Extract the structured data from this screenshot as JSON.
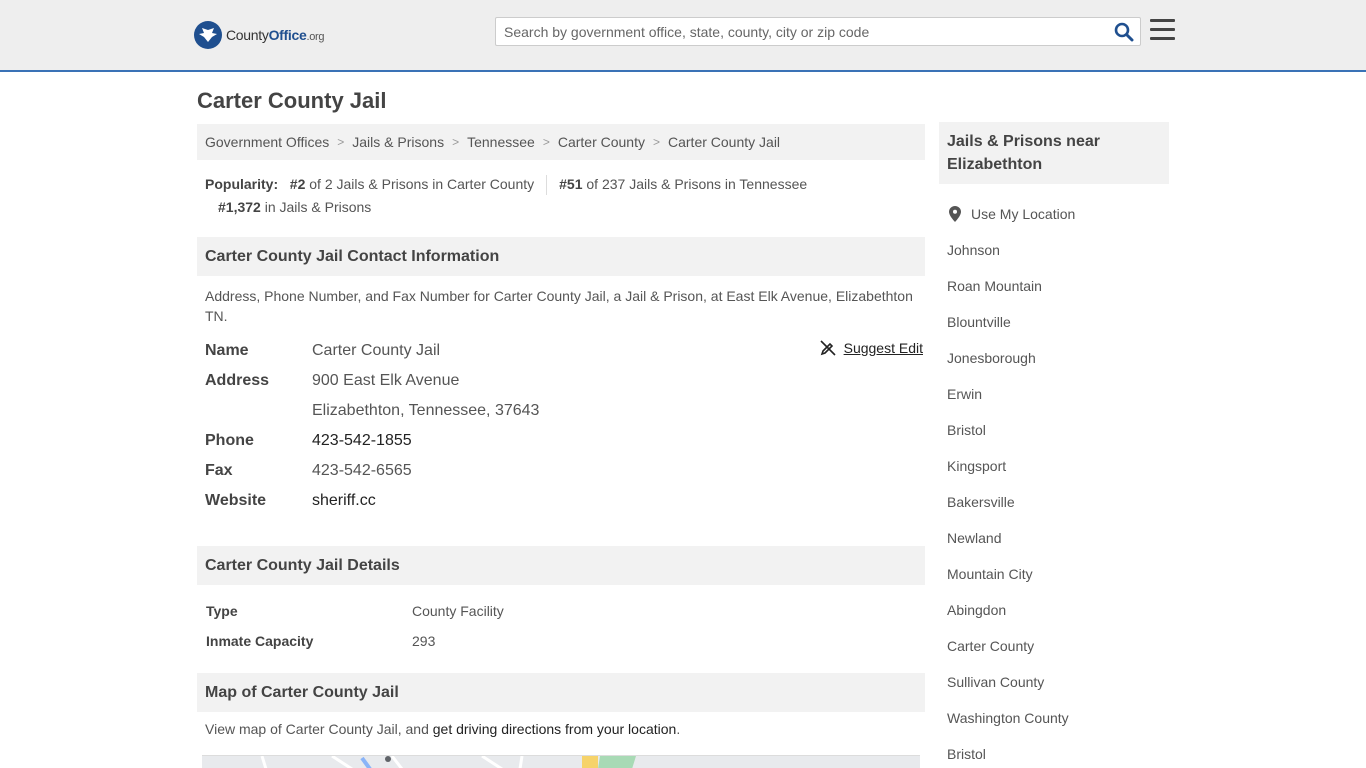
{
  "header": {
    "logo_county": "County",
    "logo_office": "Office",
    "logo_tld": ".org",
    "search_placeholder": "Search by government office, state, county, city or zip code"
  },
  "page_title": "Carter County Jail",
  "breadcrumb": [
    "Government Offices",
    "Jails & Prisons",
    "Tennessee",
    "Carter County",
    "Carter County Jail"
  ],
  "popularity": {
    "label": "Popularity:",
    "rank1": "#2",
    "rank1_text": "of 2 Jails & Prisons in Carter County",
    "rank2": "#51",
    "rank2_text": "of 237 Jails & Prisons in Tennessee",
    "rank3": "#1,372",
    "rank3_text": "in Jails & Prisons"
  },
  "contact": {
    "heading": "Carter County Jail Contact Information",
    "description": "Address, Phone Number, and Fax Number for Carter County Jail, a Jail & Prison, at East Elk Avenue, Elizabethton TN.",
    "suggest_edit": "Suggest Edit",
    "name_label": "Name",
    "name": "Carter County Jail",
    "address_label": "Address",
    "address_line1": "900 East Elk Avenue",
    "address_line2": "Elizabethton, Tennessee, 37643",
    "phone_label": "Phone",
    "phone": "423-542-1855",
    "fax_label": "Fax",
    "fax": "423-542-6565",
    "website_label": "Website",
    "website": "sheriff.cc"
  },
  "details": {
    "heading": "Carter County Jail Details",
    "rows": [
      {
        "label": "Type",
        "value": "County Facility"
      },
      {
        "label": "Inmate Capacity",
        "value": "293"
      }
    ]
  },
  "map": {
    "heading": "Map of Carter County Jail",
    "text_before": "View map of Carter County Jail, and ",
    "link": "get driving directions from your location",
    "text_after": "."
  },
  "sidebar": {
    "heading": "Jails & Prisons near Elizabethton",
    "use_location": "Use My Location",
    "items": [
      "Johnson",
      "Roan Mountain",
      "Blountville",
      "Jonesborough",
      "Erwin",
      "Bristol",
      "Kingsport",
      "Bakersville",
      "Newland",
      "Mountain City",
      "Abingdon",
      "Carter County",
      "Sullivan County",
      "Washington County",
      "Bristol"
    ]
  },
  "colors": {
    "accent": "#3a72b6",
    "brand": "#1f4f8f",
    "panel": "#f2f2f2"
  }
}
